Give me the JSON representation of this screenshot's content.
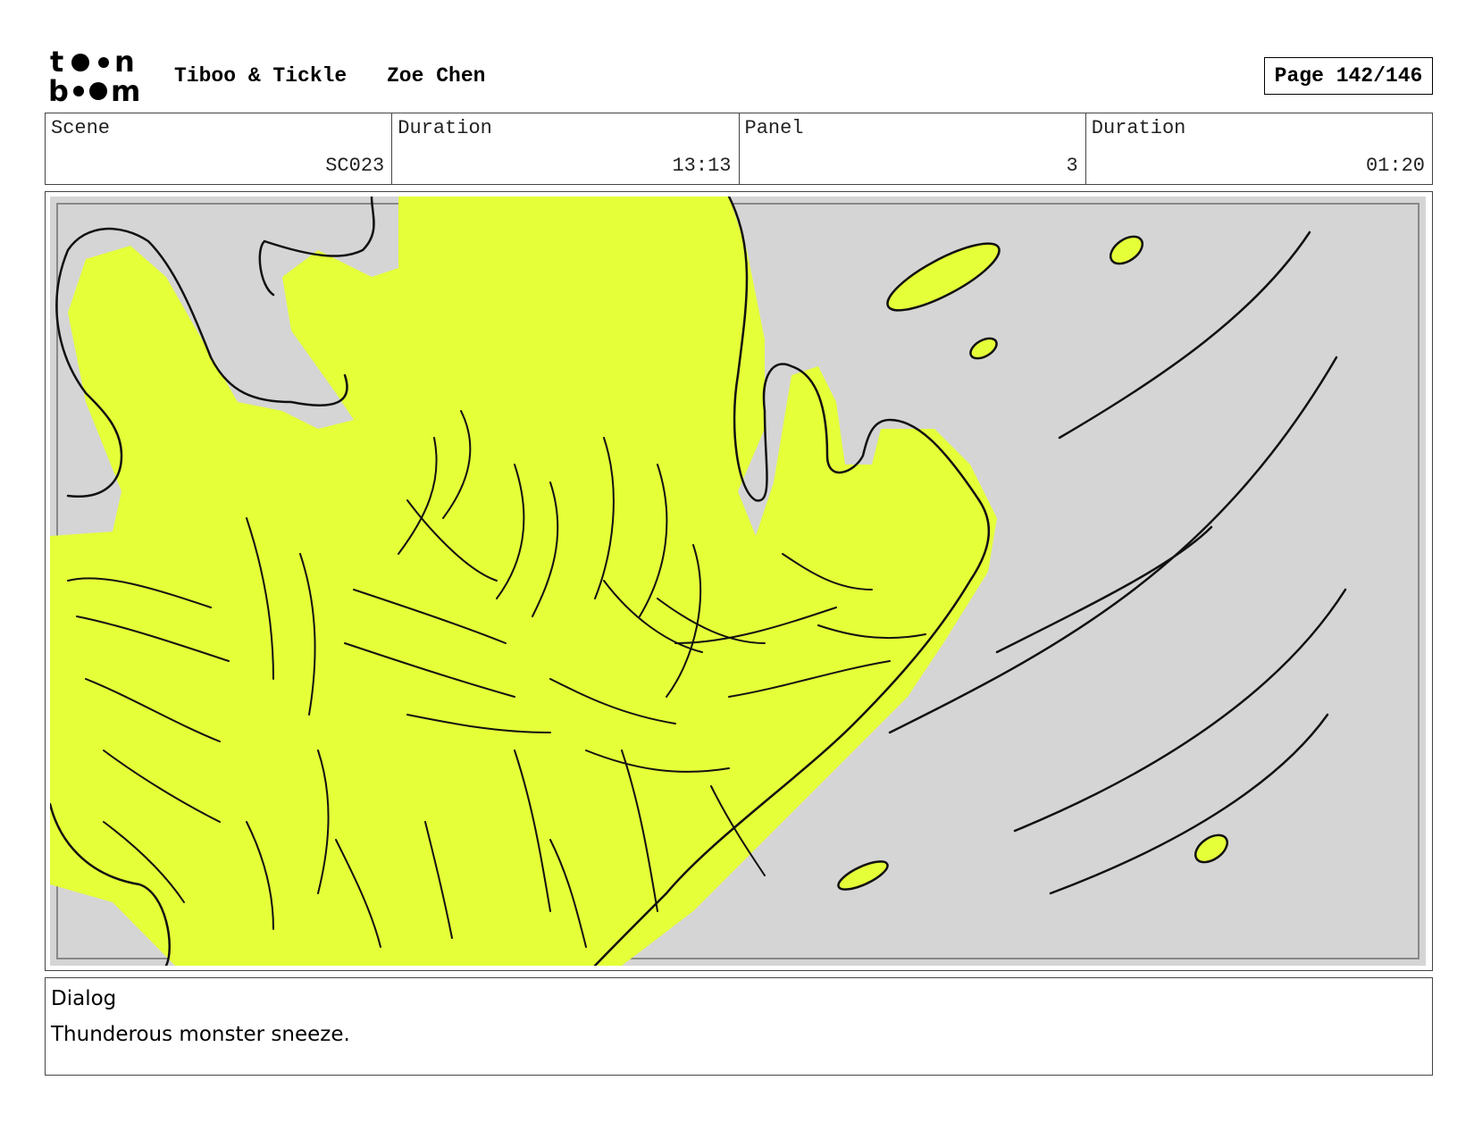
{
  "header": {
    "logo_text": "toon boom",
    "show_title": "Tiboo & Tickle",
    "artist": "Zoe Chen",
    "page_prefix": "Page",
    "page_number": "142/146"
  },
  "info": {
    "scene_label": "Scene",
    "scene_value": "SC023",
    "scene_duration_label": "Duration",
    "scene_duration_value": "13:13",
    "panel_label": "Panel",
    "panel_value": "3",
    "panel_duration_label": "Duration",
    "panel_duration_value": "01:20"
  },
  "panel": {
    "colors": {
      "background": "#d5d5d5",
      "monster": "#e5ff39",
      "ink": "#111111"
    }
  },
  "dialog": {
    "label": "Dialog",
    "text": "Thunderous monster sneeze."
  }
}
